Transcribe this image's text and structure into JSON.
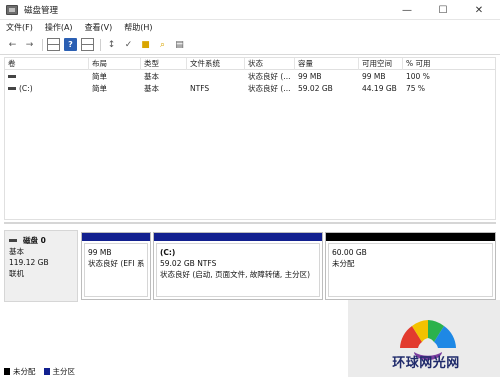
{
  "window": {
    "title": "磁盘管理",
    "controls": {
      "minimize": "—",
      "maximize": "☐",
      "close": "✕"
    }
  },
  "menu": [
    "文件(F)",
    "操作(A)",
    "查看(V)",
    "帮助(H)"
  ],
  "toolbar": {
    "icons": [
      "back-arrow-icon",
      "forward-arrow-icon",
      "grid-icon",
      "help-icon",
      "grid-icon",
      "connect-icon",
      "check-icon",
      "folder-icon",
      "search-icon",
      "properties-icon"
    ]
  },
  "volume_list": {
    "columns": [
      "卷",
      "布局",
      "类型",
      "文件系统",
      "状态",
      "容量",
      "可用空间",
      "% 可用"
    ],
    "rows": [
      {
        "volume": "",
        "layout": "简单",
        "type": "基本",
        "fs": "",
        "status": "状态良好 (...",
        "capacity": "99 MB",
        "free": "99 MB",
        "pct": "100 %"
      },
      {
        "volume": "(C:)",
        "layout": "简单",
        "type": "基本",
        "fs": "NTFS",
        "status": "状态良好 (...",
        "capacity": "59.02 GB",
        "free": "44.19 GB",
        "pct": "75 %"
      }
    ]
  },
  "disk": {
    "name": "磁盘 0",
    "type": "基本",
    "size": "119.12 GB",
    "state": "联机",
    "partitions": [
      {
        "label": "",
        "size": "99 MB",
        "status": "状态良好 (EFI 系",
        "bar_color": "#12208f"
      },
      {
        "label": "(C:)",
        "size": "59.02 GB NTFS",
        "status": "状态良好 (启动, 页面文件, 故障转储, 主分区)",
        "bar_color": "#12208f"
      },
      {
        "label": "",
        "size": "60.00 GB",
        "status": "未分配",
        "bar_color": "#000000"
      }
    ]
  },
  "legend": [
    {
      "label": "未分配",
      "color": "#000000"
    },
    {
      "label": "主分区",
      "color": "#12208f"
    }
  ],
  "watermark": {
    "text": "环球网光网"
  }
}
